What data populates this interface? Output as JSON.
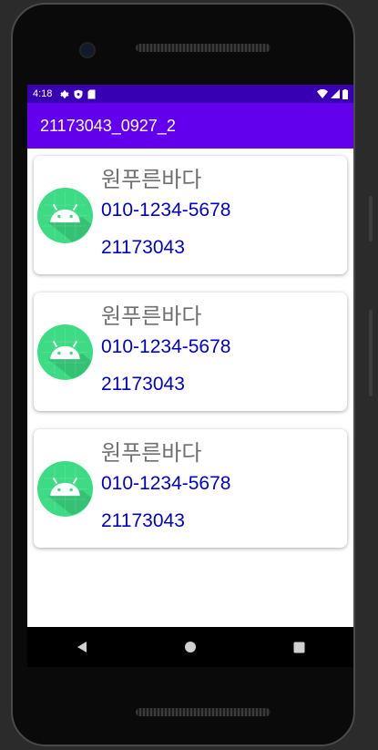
{
  "status_bar": {
    "time": "4:18",
    "icons": [
      "gear-icon",
      "shield-icon",
      "sim-card-icon"
    ],
    "right_icons": [
      "wifi-icon",
      "signal-icon",
      "battery-icon"
    ]
  },
  "app_bar": {
    "title": "21173043_0927_2"
  },
  "cards": [
    {
      "name": "원푸른바다",
      "phone": "010-1234-5678",
      "id": "21173043",
      "avatar_icon": "android-icon"
    },
    {
      "name": "원푸른바다",
      "phone": "010-1234-5678",
      "id": "21173043",
      "avatar_icon": "android-icon"
    },
    {
      "name": "원푸른바다",
      "phone": "010-1234-5678",
      "id": "21173043",
      "avatar_icon": "android-icon"
    }
  ],
  "nav_bar": {
    "buttons": [
      "back-icon",
      "home-icon",
      "recents-icon"
    ]
  },
  "colors": {
    "status_bar": "#3700b3",
    "app_bar": "#6200ee",
    "name_text": "#707070",
    "detail_text": "#0000cc",
    "android_green": "#3ddc84"
  }
}
